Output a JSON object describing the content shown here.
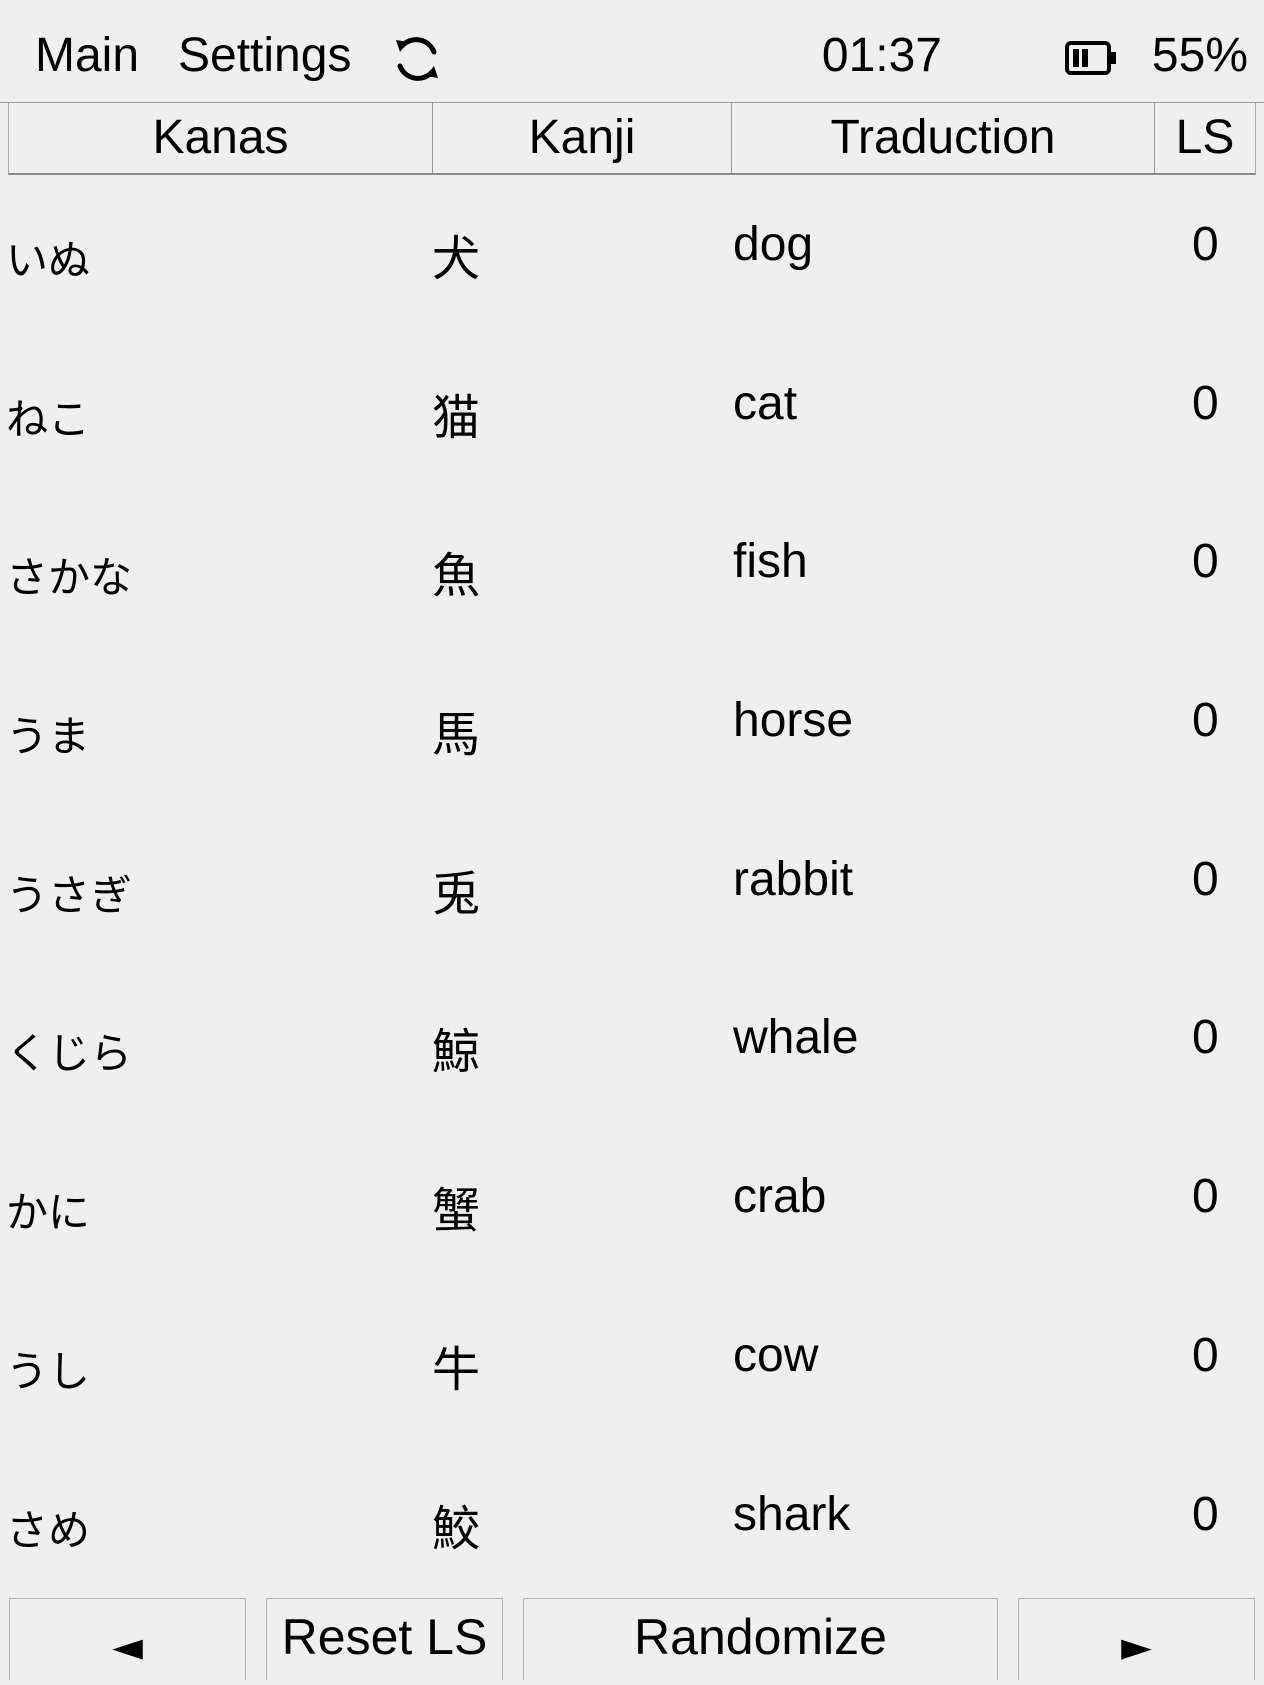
{
  "topbar": {
    "menu_main": "Main",
    "menu_settings": "Settings",
    "sync_icon": "sync-icon",
    "clock": "01:37",
    "battery_icon": "battery-icon",
    "battery_percent": "55%"
  },
  "table": {
    "columns": [
      "Kanas",
      "Kanji",
      "Traduction",
      "LS"
    ],
    "rows": [
      {
        "kana": "いぬ",
        "kanji": "犬",
        "traduction": "dog",
        "ls": "0"
      },
      {
        "kana": "ねこ",
        "kanji": "猫",
        "traduction": "cat",
        "ls": "0"
      },
      {
        "kana": "さかな",
        "kanji": "魚",
        "traduction": "fish",
        "ls": "0"
      },
      {
        "kana": "うま",
        "kanji": "馬",
        "traduction": "horse",
        "ls": "0"
      },
      {
        "kana": "うさぎ",
        "kanji": "兎",
        "traduction": "rabbit",
        "ls": "0"
      },
      {
        "kana": "くじら",
        "kanji": "鯨",
        "traduction": "whale",
        "ls": "0"
      },
      {
        "kana": "かに",
        "kanji": "蟹",
        "traduction": "crab",
        "ls": "0"
      },
      {
        "kana": "うし",
        "kanji": "牛",
        "traduction": "cow",
        "ls": "0"
      },
      {
        "kana": "さめ",
        "kanji": "鮫",
        "traduction": "shark",
        "ls": "0"
      }
    ]
  },
  "bottombar": {
    "prev": "◄",
    "reset": "Reset LS",
    "randomize": "Randomize",
    "next": "►"
  }
}
